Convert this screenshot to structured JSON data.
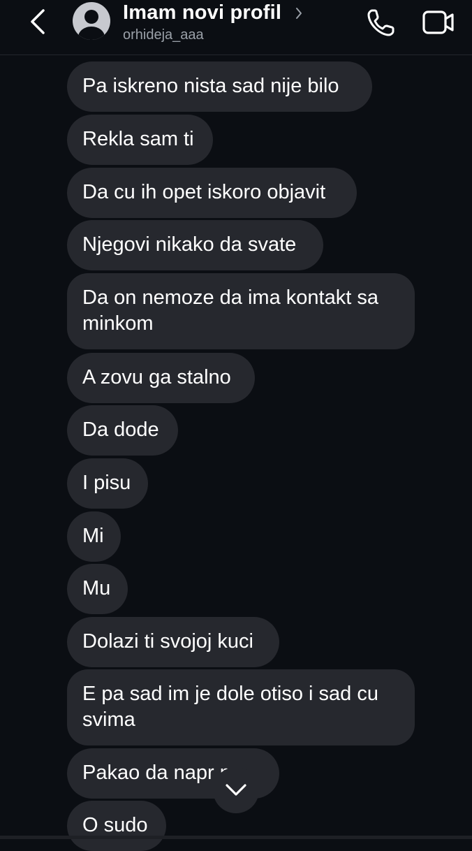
{
  "header": {
    "title": "Imam novi profil",
    "username": "orhideja_aaa"
  },
  "messages": [
    {
      "text": "Pa  iskreno nista sad nije bilo"
    },
    {
      "text": "Rekla sam ti"
    },
    {
      "text": "Da cu ih opet iskoro objavit"
    },
    {
      "text": "Njegovi nikako da svate"
    },
    {
      "line1": "Da on nemoze da ima kontakt sa",
      "line2": "minkom"
    },
    {
      "text": "A zovu ga stalno"
    },
    {
      "text": "Da dode"
    },
    {
      "text": "I pisu"
    },
    {
      "text": "Mi"
    },
    {
      "text": "Mu"
    },
    {
      "text": "Dolazi ti svojoj kuci"
    },
    {
      "line1": "E pa sad im je dole otiso i sad cu",
      "line2": "svima"
    },
    {
      "text": "Pakao da napr   m"
    },
    {
      "text": "O sudo"
    }
  ],
  "colors": {
    "background": "#0b0e13",
    "bubble": "#26282e",
    "secondary_text": "#9aa0a8"
  },
  "icons": [
    "back-arrow-icon",
    "avatar-placeholder-icon",
    "chevron-right-icon",
    "phone-icon",
    "video-call-icon",
    "chevron-down-icon"
  ]
}
